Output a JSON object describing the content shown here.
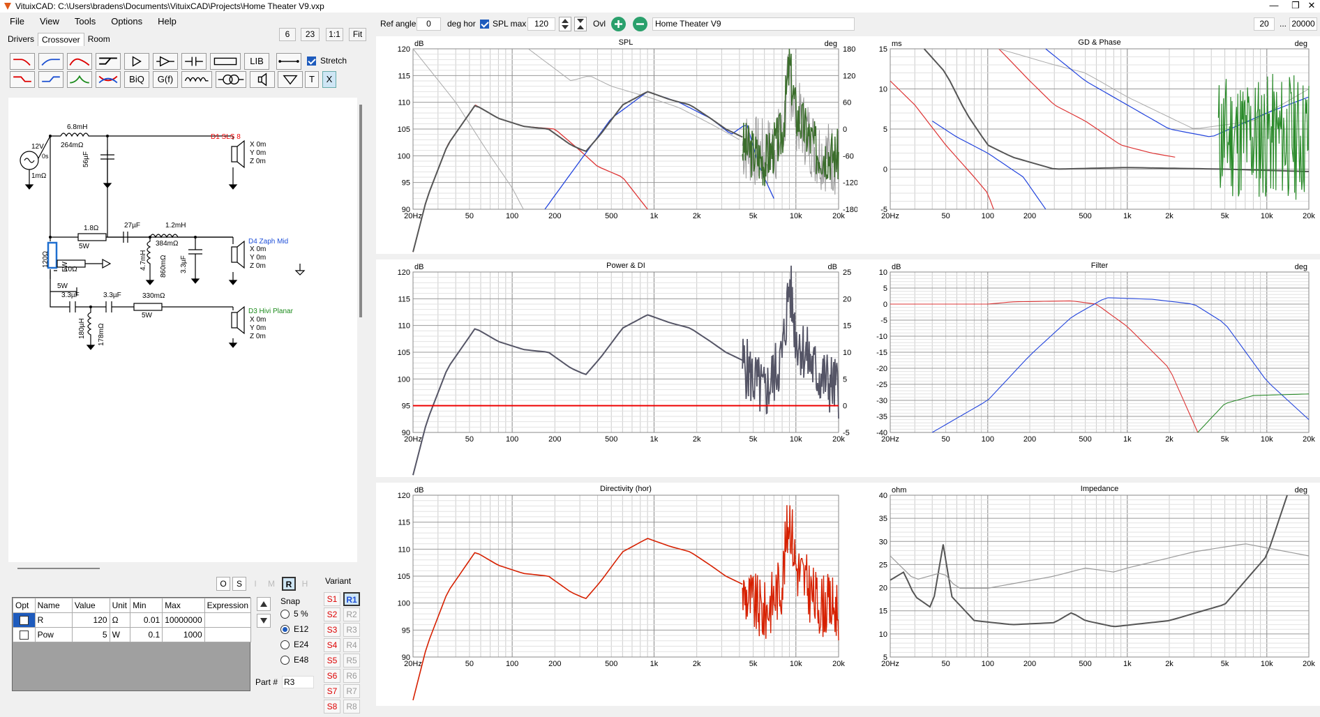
{
  "title": "VituixCAD: C:\\Users\\bradens\\Documents\\VituixCAD\\Projects\\Home Theater V9.vxp",
  "menu": [
    "File",
    "View",
    "Tools",
    "Options",
    "Help"
  ],
  "tabs": [
    "Drivers",
    "Crossover",
    "Room"
  ],
  "zoom": {
    "b6": "6",
    "b23": "23",
    "b11": "1:1",
    "fit": "Fit"
  },
  "toolbar": {
    "lib": "LIB",
    "biq": "BiQ",
    "gf": "G(f)",
    "t": "T",
    "x": "X",
    "stretch": "Stretch"
  },
  "schematic": {
    "source": "12V",
    "src_res": "1mΩ",
    "src_zero": "0s",
    "l1": "6.8mH",
    "l1r": "264mΩ",
    "c1": "56µF",
    "d1": "D1 SLS 8",
    "d4": "D4 Zaph Mid",
    "d3": "D3 Hivi Planar",
    "coords": [
      "X 0m",
      "Y 0m",
      "Z 0m"
    ],
    "r18": "1.8Ω",
    "r18w": "5W",
    "c27": "27µF",
    "l12": "1.2mH",
    "l12r": "384mΩ",
    "l47": "4.7mH",
    "l47r": "860mΩ",
    "c33a": "3.3µF",
    "r120": "120Ω",
    "r120w": "5W",
    "r10": "10Ω",
    "r10w": "5W",
    "c33b": "3.3µF",
    "c33c": "3.3µF",
    "r330": "330mΩ",
    "r330w": "5W",
    "l180": "180µH",
    "l180r": "178mΩ"
  },
  "selector": [
    "O",
    "S",
    "I",
    "M",
    "R",
    "H"
  ],
  "table": {
    "headers": [
      "Opt",
      "Name",
      "Value",
      "Unit",
      "Min",
      "Max",
      "Expression"
    ],
    "rows": [
      {
        "name": "R",
        "value": "120",
        "unit": "Ω",
        "min": "0.01",
        "max": "10000000",
        "expr": ""
      },
      {
        "name": "Pow",
        "value": "5",
        "unit": "W",
        "min": "0.1",
        "max": "1000",
        "expr": ""
      }
    ]
  },
  "snap": {
    "label": "Snap",
    "options": [
      "5 %",
      "E12",
      "E24",
      "E48"
    ],
    "selected": "E12"
  },
  "variant": {
    "label": "Variant",
    "s": [
      "S1",
      "S2",
      "S3",
      "S4",
      "S5",
      "S6",
      "S7",
      "S8"
    ],
    "r": [
      "R1",
      "R2",
      "R3",
      "R4",
      "R5",
      "R6",
      "R7",
      "R8"
    ]
  },
  "part": {
    "label": "Part #",
    "value": "R3"
  },
  "top": {
    "ref_angle": "Ref angle",
    "ref_value": "0",
    "deg_hor": "deg hor",
    "spl_max": "SPL max",
    "spl_value": "120",
    "ovl": "Ovl",
    "name": "Home Theater V9",
    "fmin": "20",
    "dots": "...",
    "fmax": "20000"
  },
  "xticks": [
    "20Hz",
    "50",
    "100",
    "200",
    "500",
    "1k",
    "2k",
    "5k",
    "10k",
    "20k"
  ],
  "graphs": [
    {
      "title": "SPL",
      "lunit": "dB",
      "runit": "deg",
      "left": [
        "120",
        "115",
        "110",
        "105",
        "100",
        "95",
        "90"
      ],
      "right": [
        "180",
        "120",
        "60",
        "0",
        "-60",
        "-120",
        "-180"
      ]
    },
    {
      "title": "GD & Phase",
      "lunit": "ms",
      "runit": "deg",
      "left": [
        "15",
        "10",
        "5",
        "0",
        "-5"
      ],
      "right": []
    },
    {
      "title": "Power & DI",
      "lunit": "dB",
      "runit": "dB",
      "left": [
        "120",
        "115",
        "110",
        "105",
        "100",
        "95",
        "90"
      ],
      "right": [
        "25",
        "20",
        "15",
        "10",
        "5",
        "0",
        "-5"
      ]
    },
    {
      "title": "Filter",
      "lunit": "dB",
      "runit": "deg",
      "left": [
        "10",
        "5",
        "0",
        "-5",
        "-10",
        "-15",
        "-20",
        "-25",
        "-30",
        "-35",
        "-40"
      ],
      "right": []
    },
    {
      "title": "Directivity (hor)",
      "lunit": "dB",
      "runit": "",
      "left": [
        "120",
        "115",
        "110",
        "105",
        "100",
        "95",
        "90"
      ],
      "right": []
    },
    {
      "title": "Impedance",
      "lunit": "ohm",
      "runit": "deg",
      "left": [
        "40",
        "35",
        "30",
        "25",
        "20",
        "15",
        "10",
        "5"
      ],
      "right": []
    }
  ]
}
